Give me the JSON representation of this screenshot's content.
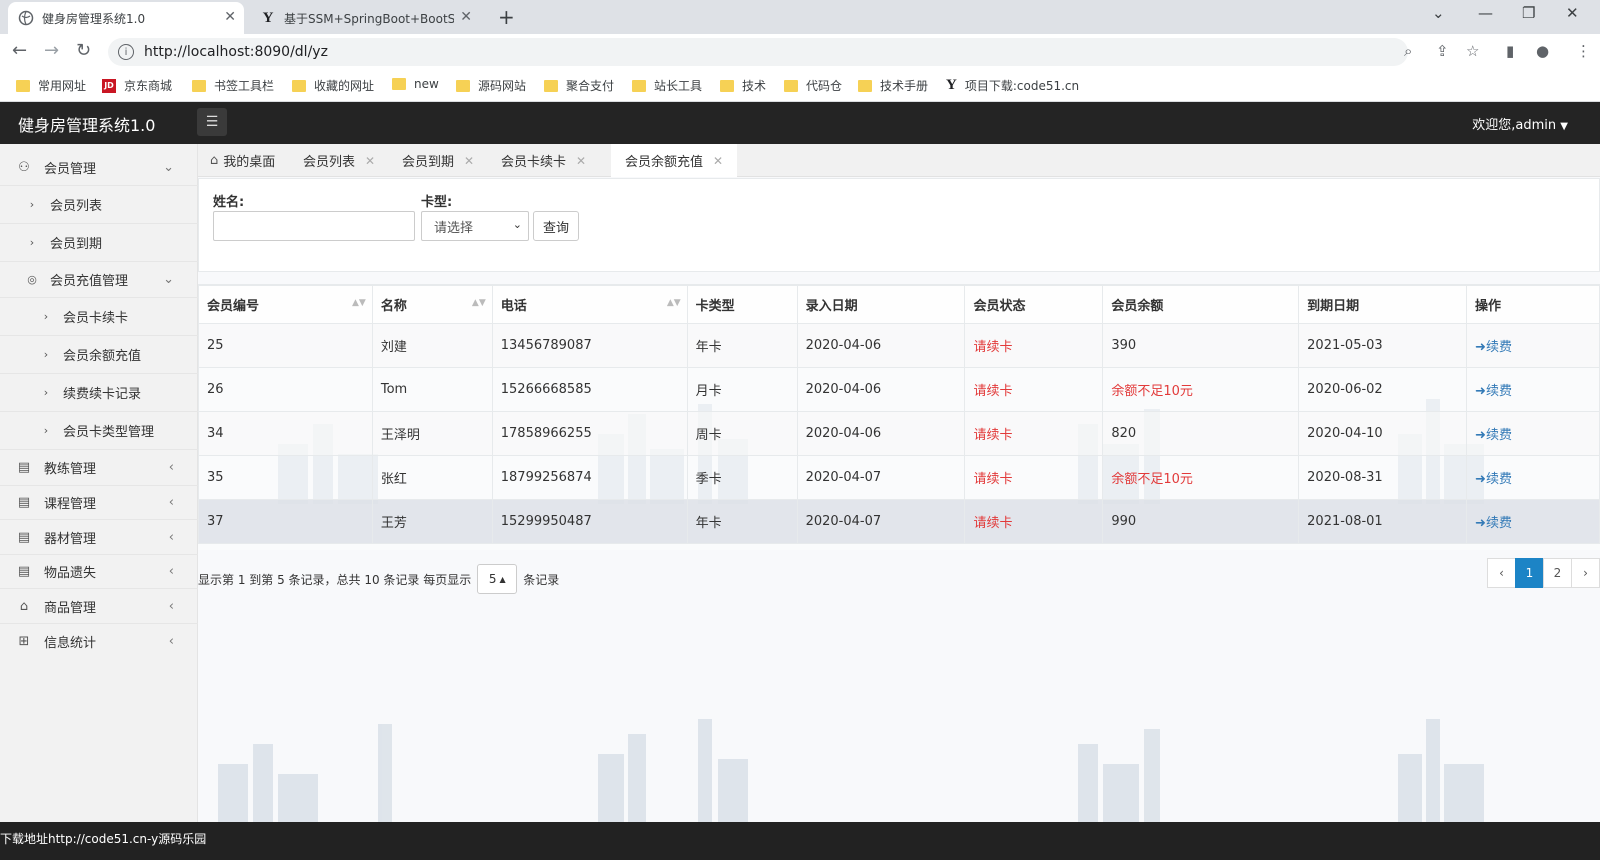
{
  "browser": {
    "tabs": [
      {
        "title": "健身房管理系统1.0"
      },
      {
        "title": "基于SSM+SpringBoot+BootSt"
      }
    ],
    "url": "http://localhost:8090/dl/yz",
    "bookmarks": [
      "常用网址",
      "京东商城",
      "书签工具栏",
      "收藏的网址",
      "new",
      "源码网站",
      "聚合支付",
      "站长工具",
      "技术",
      "代码仓",
      "技术手册",
      "项目下载:code51.cn"
    ]
  },
  "app": {
    "title": "健身房管理系统1.0",
    "user": "欢迎您,admin"
  },
  "sidebar": {
    "items": [
      {
        "label": "会员管理"
      },
      {
        "label": "会员列表"
      },
      {
        "label": "会员到期"
      },
      {
        "label": "会员充值管理"
      },
      {
        "label": "会员卡续卡"
      },
      {
        "label": "会员余额充值"
      },
      {
        "label": "续费续卡记录"
      },
      {
        "label": "会员卡类型管理"
      },
      {
        "label": "教练管理"
      },
      {
        "label": "课程管理"
      },
      {
        "label": "器材管理"
      },
      {
        "label": "物品遗失"
      },
      {
        "label": "商品管理"
      },
      {
        "label": "信息统计"
      }
    ]
  },
  "content_tabs": [
    {
      "label": "我的桌面"
    },
    {
      "label": "会员列表"
    },
    {
      "label": "会员到期"
    },
    {
      "label": "会员卡续卡"
    },
    {
      "label": "会员余额充值"
    }
  ],
  "search": {
    "name_label": "姓名:",
    "name_value": "",
    "card_label": "卡型:",
    "card_selected": "请选择",
    "query_label": "查询"
  },
  "table": {
    "headers": [
      "会员编号",
      "名称",
      "电话",
      "卡类型",
      "录入日期",
      "会员状态",
      "会员余额",
      "到期日期",
      "操作"
    ],
    "rows": [
      [
        "25",
        "刘建",
        "13456789087",
        "年卡",
        "2020-04-06",
        "请续卡",
        "390",
        "2021-05-03",
        "续费"
      ],
      [
        "26",
        "Tom",
        "15266668585",
        "月卡",
        "2020-04-06",
        "请续卡",
        "余额不足10元",
        "2020-06-02",
        "续费"
      ],
      [
        "34",
        "王泽明",
        "17858966255",
        "周卡",
        "2020-04-06",
        "请续卡",
        "820",
        "2020-04-10",
        "续费"
      ],
      [
        "35",
        "张红",
        "18799256874",
        "季卡",
        "2020-04-07",
        "请续卡",
        "余额不足10元",
        "2020-08-31",
        "续费"
      ],
      [
        "37",
        "王芳",
        "15299950487",
        "年卡",
        "2020-04-07",
        "请续卡",
        "990",
        "2021-08-01",
        "续费"
      ]
    ]
  },
  "pager": {
    "summary": "显示第 1 到第 5 条记录，总共 10 条记录 每页显示",
    "page_size": "5",
    "suffix": "条记录",
    "prev": "‹",
    "pages": [
      "1",
      "2"
    ],
    "next": "›"
  },
  "status": "下载地址http://code51.cn-y源码乐园"
}
